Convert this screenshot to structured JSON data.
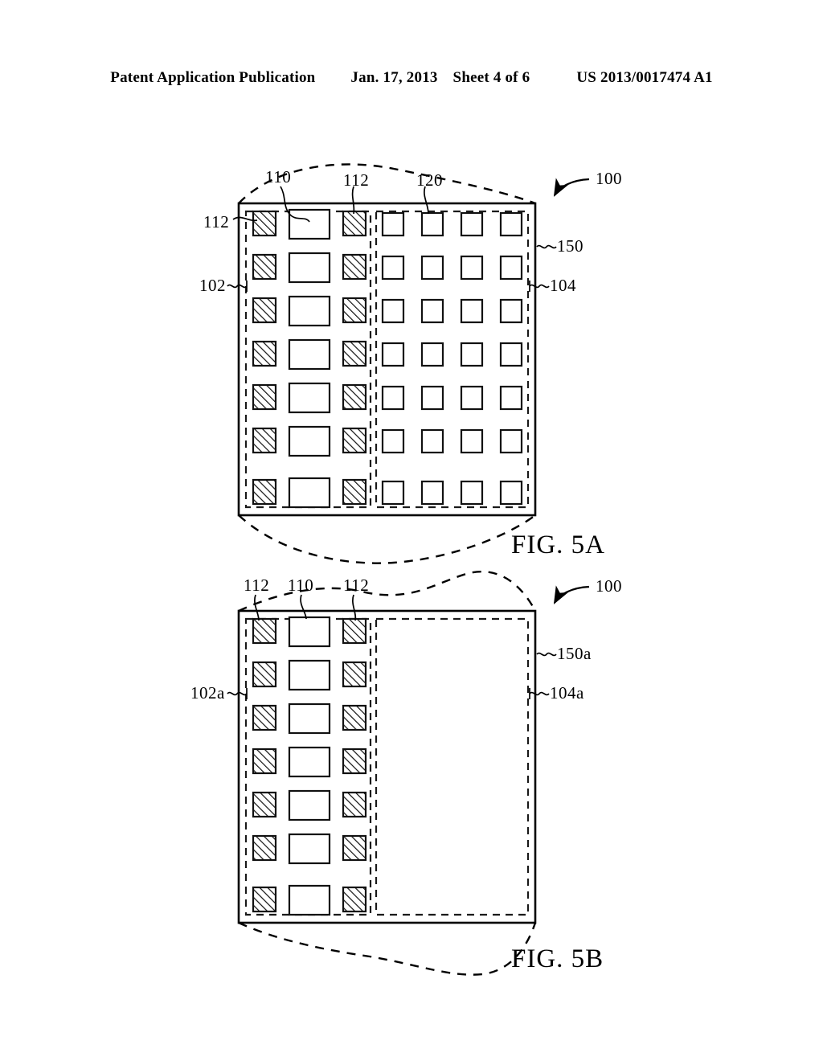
{
  "header": {
    "left": "Patent Application Publication",
    "date": "Jan. 17, 2013",
    "sheet": "Sheet 4 of 6",
    "pub_number": "US 2013/0017474 A1"
  },
  "figures": [
    {
      "id": "fig-5a",
      "caption": "FIG. 5A",
      "device_label": "100",
      "package_label": "150",
      "left_region_label": "102",
      "right_region_label": "104",
      "callouts": [
        {
          "name": "callout-110-top",
          "text": "110"
        },
        {
          "name": "callout-112-top",
          "text": "112"
        },
        {
          "name": "callout-120-top",
          "text": "120"
        },
        {
          "name": "callout-112-left",
          "text": "112"
        }
      ],
      "left_region": {
        "rows": 7,
        "columns": [
          "hatched-pad",
          "plain-rect-pad",
          "hatched-pad"
        ]
      },
      "right_region": {
        "rows": 7,
        "columns": [
          "plain-square-pad",
          "plain-square-pad",
          "plain-square-pad",
          "plain-square-pad"
        ]
      }
    },
    {
      "id": "fig-5b",
      "caption": "FIG. 5B",
      "device_label": "100",
      "package_label": "150a",
      "left_region_label": "102a",
      "right_region_label": "104a",
      "callouts": [
        {
          "name": "callout-112-top-left",
          "text": "112"
        },
        {
          "name": "callout-110-top",
          "text": "110"
        },
        {
          "name": "callout-112-top-right",
          "text": "112"
        }
      ],
      "left_region": {
        "rows": 7,
        "columns": [
          "hatched-pad",
          "plain-rect-pad",
          "hatched-pad"
        ]
      },
      "right_region": {
        "rows": 0,
        "columns": []
      }
    }
  ],
  "colors": {
    "ink": "#000000",
    "paper": "#ffffff"
  }
}
